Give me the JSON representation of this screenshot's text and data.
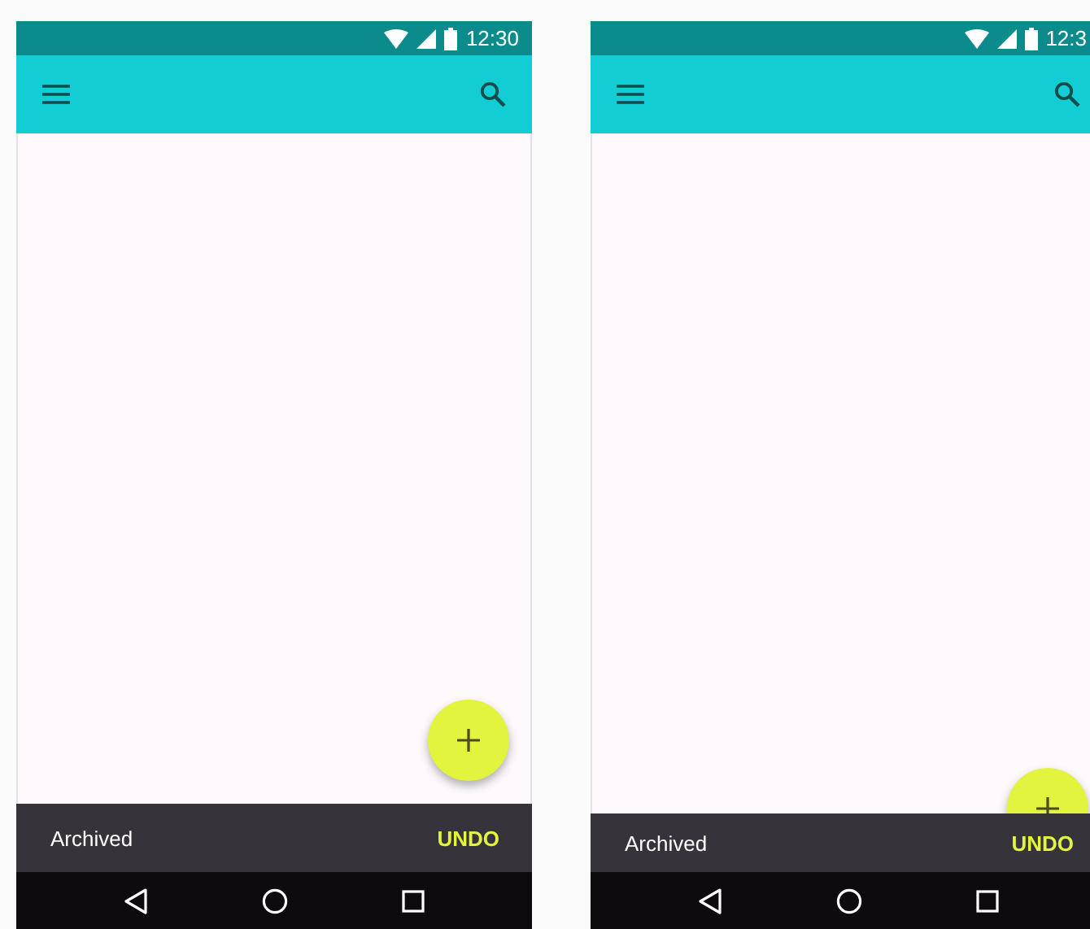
{
  "phones": [
    {
      "status_bar": {
        "time": "12:30"
      },
      "snackbar": {
        "message": "Archived",
        "action": "UNDO"
      }
    },
    {
      "status_bar": {
        "time": "12:3"
      },
      "snackbar": {
        "message": "Archived",
        "action": "UNDO"
      }
    }
  ]
}
